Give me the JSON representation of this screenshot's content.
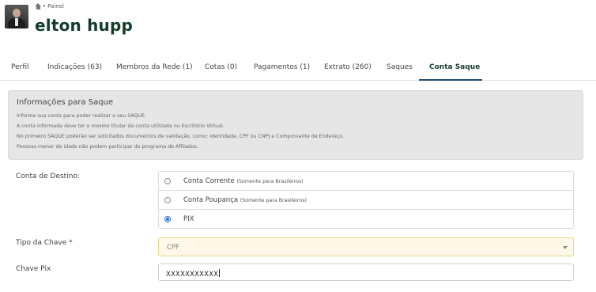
{
  "breadcrumb": {
    "label": "Painel"
  },
  "user": {
    "name": "elton hupp"
  },
  "tabs": [
    {
      "label": "Perfil"
    },
    {
      "label": "Indicações (63)"
    },
    {
      "label": "Membros da Rede (1)"
    },
    {
      "label": "Cotas (0)"
    },
    {
      "label": "Pagamentos (1)"
    },
    {
      "label": "Extrato (260)"
    },
    {
      "label": "Saques"
    },
    {
      "label": "Conta Saque"
    }
  ],
  "active_tab": "Conta Saque",
  "info": {
    "title": "Informações para Saque",
    "lines": [
      "Informe sua conta para poder realizar o seu SAQUE.",
      "A conta informada deve ter o mesmo titular da conta utilizada no Escritório Virtual.",
      "No primeiro SAQUE poderão ser solicitados documentos de validação, como: Identidade, CPF ou CNPJ e Comprovante de Endereço.",
      "Pessoas menor de idade não podem participar do programa de Afiliados."
    ]
  },
  "form": {
    "destination_label": "Conta de Destino:",
    "destination_options": [
      {
        "label": "Conta Corrente",
        "note": "(Somente para Brasileiros)",
        "checked": false
      },
      {
        "label": "Conta Poupança",
        "note": "(Somente para Brasileiros)",
        "checked": false
      },
      {
        "label": "PIX",
        "note": "",
        "checked": true
      }
    ],
    "key_type_label": "Tipo da Chave *",
    "key_type_value": "CPF",
    "pix_key_label": "Chave Pix",
    "pix_key_value": "XXXXXXXXXXX"
  }
}
